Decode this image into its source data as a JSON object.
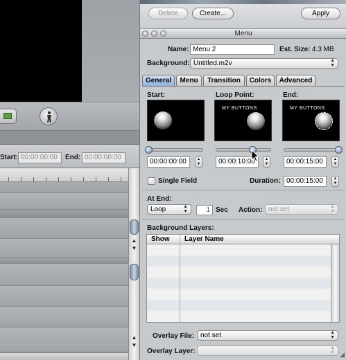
{
  "background_app": {
    "timecode": {
      "start_label": "Start:",
      "start_value": "00:00:00:00",
      "end_label": "End:",
      "end_value": "00:00:00:00"
    }
  },
  "toolbar": {
    "delete_label": "Delete",
    "create_label": "Create...",
    "apply_label": "Apply"
  },
  "window": {
    "title": "Menu"
  },
  "menu": {
    "name_label": "Name:",
    "name_value": "Menu 2",
    "est_size_label": "Est. Size:",
    "est_size_value": "4.3 MB",
    "background_label": "Background:",
    "background_value": "Untitled.m2v"
  },
  "tabs": [
    {
      "label": "General",
      "selected": true
    },
    {
      "label": "Menu",
      "selected": false
    },
    {
      "label": "Transition",
      "selected": false
    },
    {
      "label": "Colors",
      "selected": false
    },
    {
      "label": "Advanced",
      "selected": false
    }
  ],
  "previews": {
    "start_label": "Start:",
    "loop_label": "Loop Point:",
    "end_label": "End:",
    "loop_caption": "MY BUTTONS",
    "end_caption": "MY BUTTONS"
  },
  "slider_positions": {
    "start": 0.0,
    "loop": 0.667,
    "end": 1.0
  },
  "timecodes": {
    "start": "00:00:00:00",
    "loop": "00:00:10:00",
    "end": "00:00:15:00"
  },
  "single_field": {
    "label": "Single Field",
    "checked": false
  },
  "duration": {
    "label": "Duration:",
    "value": "00:00:15:00"
  },
  "at_end": {
    "label": "At End:",
    "value": "Loop",
    "count": "1",
    "unit": "Sec",
    "action_label": "Action:",
    "action_value": "not set"
  },
  "background_layers": {
    "title": "Background Layers:",
    "col_show": "Show",
    "col_layer_name": "Layer Name"
  },
  "overlay": {
    "file_label": "Overlay File:",
    "file_value": "not set",
    "layer_label": "Overlay Layer:",
    "layer_value": ""
  },
  "colors": {
    "accent_tab": "#8eb2de",
    "panel_bg": "#c7cacd"
  }
}
